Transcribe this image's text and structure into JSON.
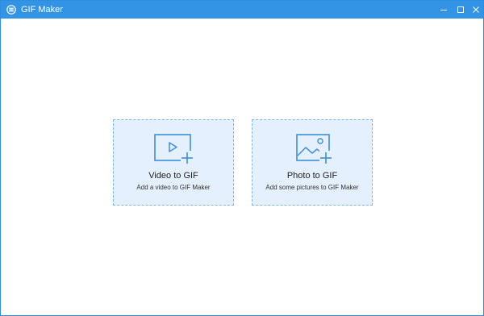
{
  "window": {
    "title": "GIF Maker",
    "app_icon": "gif-maker-icon",
    "controls": [
      "minimize-icon",
      "maximize-icon",
      "close-icon"
    ]
  },
  "colors": {
    "titlebar": "#3394e6",
    "card_background": "#e4f0fd",
    "card_border": "#7db5ea",
    "icon_stroke": "#3d8fd9"
  },
  "options": [
    {
      "title": "Video to GIF",
      "subtitle": "Add a video to GIF Maker",
      "icon": "video-add-icon"
    },
    {
      "title": "Photo to GIF",
      "subtitle": "Add some pictures to GIF Maker",
      "icon": "photo-add-icon"
    }
  ]
}
